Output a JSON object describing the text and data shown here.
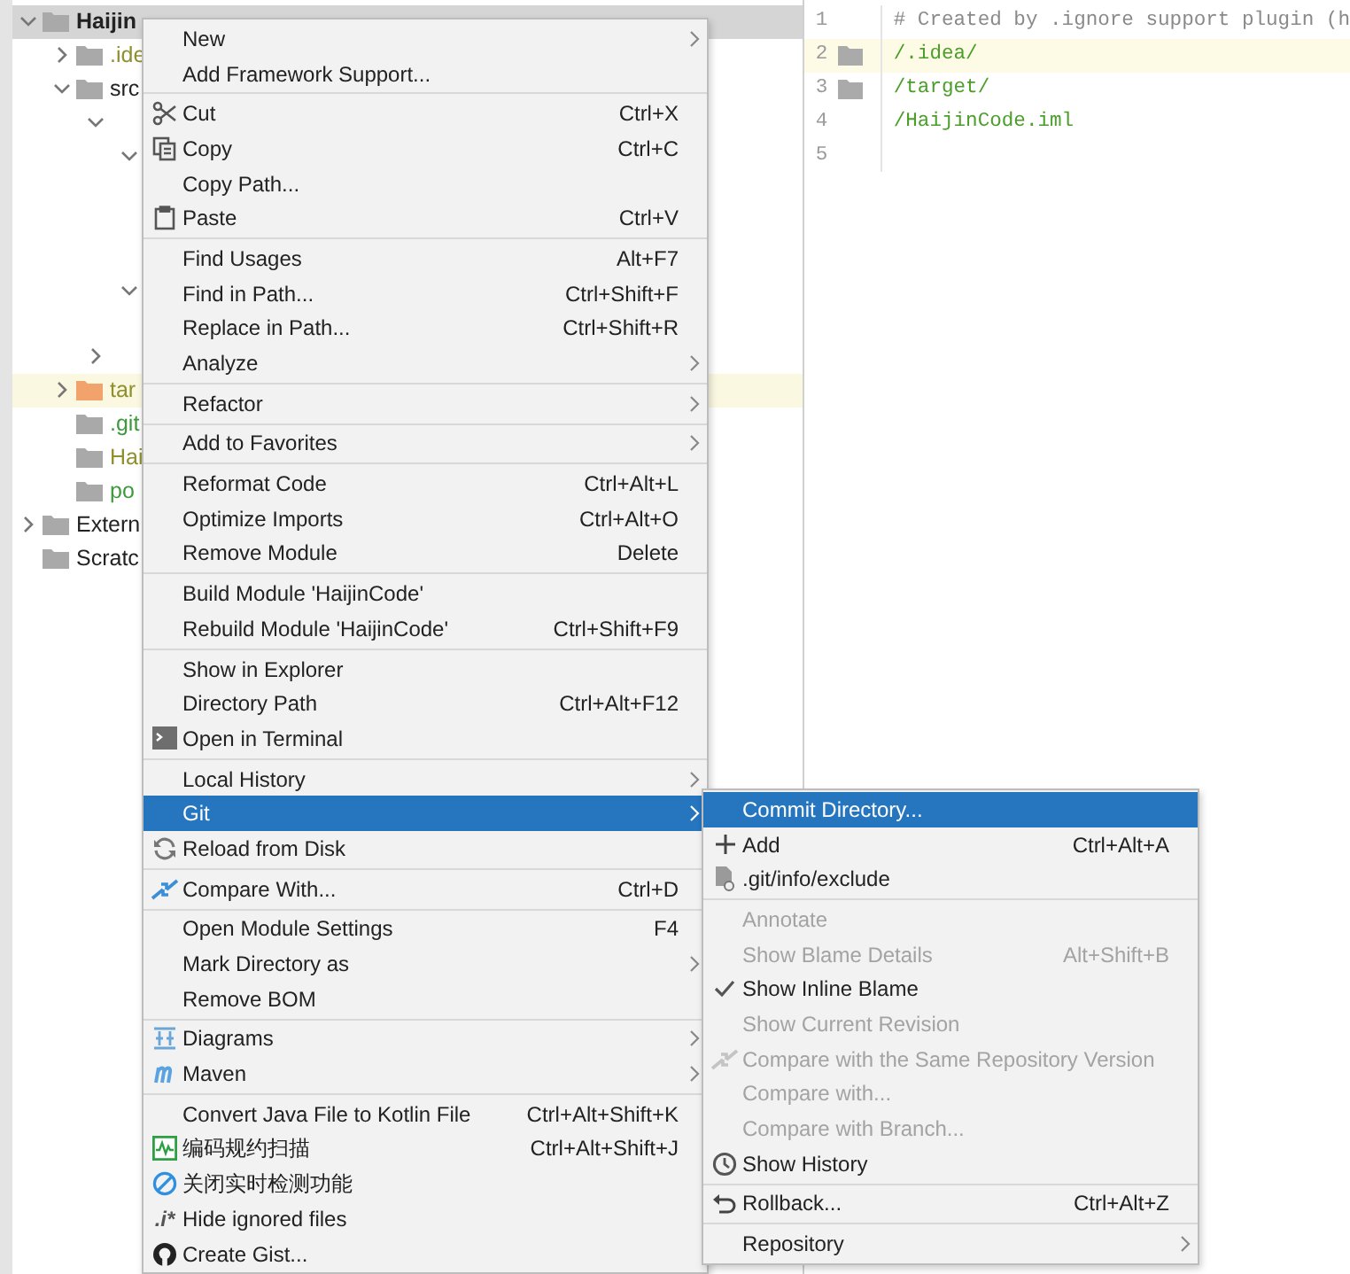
{
  "project_tree": [
    {
      "label": "Haijin",
      "bold": true,
      "expanded": true,
      "selected": true,
      "highlighted": false,
      "children": [
        {
          "label": ".ide",
          "color": "#8f8f2e",
          "expanded": false,
          "selected": false,
          "highlighted": false
        },
        {
          "label": "src",
          "expanded": true,
          "selected": false,
          "highlighted": false,
          "children": [
            {
              "expanded": true,
              "selected": false,
              "highlighted": false,
              "children": [
                {
                  "expanded": true,
                  "selected": false,
                  "highlighted": false,
                  "children": [
                    {
                      "selected": false,
                      "highlighted": false
                    },
                    {
                      "selected": false,
                      "highlighted": false
                    },
                    {
                      "selected": false,
                      "highlighted": false
                    }
                  ]
                },
                {
                  "expanded": true,
                  "selected": false,
                  "highlighted": false,
                  "children": [
                    {
                      "selected": false,
                      "highlighted": false
                    }
                  ]
                }
              ]
            },
            {
              "expanded": false,
              "selected": false,
              "highlighted": false
            }
          ]
        },
        {
          "label": "tar",
          "color": "#8f8f2e",
          "expanded": false,
          "selected": false,
          "highlighted": true
        },
        {
          "label": ".git",
          "color": "#3c9a3c",
          "selected": false,
          "highlighted": false
        },
        {
          "label": "Hai",
          "color": "#8f8f2e",
          "selected": false,
          "highlighted": false
        },
        {
          "label": "po",
          "color": "#3c9a3c",
          "selected": false,
          "highlighted": false
        }
      ]
    },
    {
      "label": "Extern",
      "expanded": false,
      "selected": false,
      "highlighted": false
    },
    {
      "label": "Scratc",
      "selected": false,
      "highlighted": false
    }
  ],
  "editor": {
    "lines": [
      {
        "number": "1",
        "text": "# Created by .ignore support plugin (h",
        "kind": "comment",
        "folder": false,
        "current": false
      },
      {
        "number": "2",
        "text": "/.idea/",
        "kind": "path",
        "folder": true,
        "current": true
      },
      {
        "number": "3",
        "text": "/target/",
        "kind": "path",
        "folder": true,
        "current": false
      },
      {
        "number": "4",
        "text": "/HaijinCode.iml",
        "kind": "path",
        "folder": false,
        "current": false
      },
      {
        "number": "5",
        "folder": false,
        "current": false
      }
    ]
  },
  "context_menu": {
    "groups": [
      [
        {
          "label": "New",
          "submenu": true,
          "selected": false
        },
        {
          "label": "Add Framework Support...",
          "submenu": false,
          "selected": false
        }
      ],
      [
        {
          "label": "Cut",
          "shortcut": "Ctrl+X",
          "submenu": false,
          "selected": false
        },
        {
          "label": "Copy",
          "shortcut": "Ctrl+C",
          "submenu": false,
          "selected": false
        },
        {
          "label": "Copy Path...",
          "submenu": false,
          "selected": false
        },
        {
          "label": "Paste",
          "shortcut": "Ctrl+V",
          "submenu": false,
          "selected": false
        }
      ],
      [
        {
          "label": "Find Usages",
          "shortcut": "Alt+F7",
          "submenu": false,
          "selected": false
        },
        {
          "label": "Find in Path...",
          "shortcut": "Ctrl+Shift+F",
          "submenu": false,
          "selected": false
        },
        {
          "label": "Replace in Path...",
          "shortcut": "Ctrl+Shift+R",
          "submenu": false,
          "selected": false
        },
        {
          "label": "Analyze",
          "submenu": true,
          "selected": false
        }
      ],
      [
        {
          "label": "Refactor",
          "submenu": true,
          "selected": false
        }
      ],
      [
        {
          "label": "Add to Favorites",
          "submenu": true,
          "selected": false
        }
      ],
      [
        {
          "label": "Reformat Code",
          "shortcut": "Ctrl+Alt+L",
          "submenu": false,
          "selected": false
        },
        {
          "label": "Optimize Imports",
          "shortcut": "Ctrl+Alt+O",
          "submenu": false,
          "selected": false
        },
        {
          "label": "Remove Module",
          "shortcut": "Delete",
          "submenu": false,
          "selected": false
        }
      ],
      [
        {
          "label": "Build Module 'HaijinCode'",
          "submenu": false,
          "selected": false
        },
        {
          "label": "Rebuild Module 'HaijinCode'",
          "shortcut": "Ctrl+Shift+F9",
          "submenu": false,
          "selected": false
        }
      ],
      [
        {
          "label": "Show in Explorer",
          "submenu": false,
          "selected": false
        },
        {
          "label": "Directory Path",
          "shortcut": "Ctrl+Alt+F12",
          "submenu": false,
          "selected": false
        },
        {
          "label": "Open in Terminal",
          "submenu": false,
          "selected": false
        }
      ],
      [
        {
          "label": "Local History",
          "submenu": true,
          "selected": false
        },
        {
          "label": "Git",
          "submenu": true,
          "selected": true
        },
        {
          "label": "Reload from Disk",
          "submenu": false,
          "selected": false
        }
      ],
      [
        {
          "label": "Compare With...",
          "shortcut": "Ctrl+D",
          "submenu": false,
          "selected": false
        }
      ],
      [
        {
          "label": "Open Module Settings",
          "shortcut": "F4",
          "submenu": false,
          "selected": false
        },
        {
          "label": "Mark Directory as",
          "submenu": true,
          "selected": false
        },
        {
          "label": "Remove BOM",
          "submenu": false,
          "selected": false
        }
      ],
      [
        {
          "label": "Diagrams",
          "submenu": true,
          "selected": false
        },
        {
          "label": "Maven",
          "submenu": true,
          "selected": false
        }
      ],
      [
        {
          "label": "Convert Java File to Kotlin File",
          "shortcut": "Ctrl+Alt+Shift+K",
          "submenu": false,
          "selected": false
        },
        {
          "label": "编码规约扫描",
          "shortcut": "Ctrl+Alt+Shift+J",
          "submenu": false,
          "selected": false
        },
        {
          "label": "关闭实时检测功能",
          "submenu": false,
          "selected": false
        },
        {
          "label": "Hide ignored files",
          "icon_text": ".i*",
          "submenu": false,
          "selected": false
        },
        {
          "label": "Create Gist...",
          "submenu": false,
          "selected": false
        }
      ]
    ]
  },
  "git_submenu": {
    "groups": [
      [
        {
          "label": "Commit Directory...",
          "submenu": false,
          "selected": true,
          "disabled": false,
          "checked": false
        },
        {
          "label": "Add",
          "shortcut": "Ctrl+Alt+A",
          "submenu": false,
          "selected": false,
          "disabled": false,
          "checked": false
        },
        {
          "label": ".git/info/exclude",
          "submenu": false,
          "selected": false,
          "disabled": false,
          "checked": false
        }
      ],
      [
        {
          "label": "Annotate",
          "submenu": false,
          "selected": false,
          "disabled": true,
          "checked": false
        },
        {
          "label": "Show Blame Details",
          "shortcut": "Alt+Shift+B",
          "submenu": false,
          "selected": false,
          "disabled": true,
          "checked": false
        },
        {
          "label": "Show Inline Blame",
          "submenu": false,
          "selected": false,
          "disabled": false,
          "checked": true
        },
        {
          "label": "Show Current Revision",
          "submenu": false,
          "selected": false,
          "disabled": true,
          "checked": false
        },
        {
          "label": "Compare with the Same Repository Version",
          "submenu": false,
          "selected": false,
          "disabled": true,
          "checked": false
        },
        {
          "label": "Compare with...",
          "submenu": false,
          "selected": false,
          "disabled": true,
          "checked": false
        },
        {
          "label": "Compare with Branch...",
          "submenu": false,
          "selected": false,
          "disabled": true,
          "checked": false
        },
        {
          "label": "Show History",
          "submenu": false,
          "selected": false,
          "disabled": false,
          "checked": false
        }
      ],
      [
        {
          "label": "Rollback...",
          "shortcut": "Ctrl+Alt+Z",
          "submenu": false,
          "selected": false,
          "disabled": false,
          "checked": false
        }
      ],
      [
        {
          "label": "Repository",
          "submenu": true,
          "selected": false,
          "disabled": false,
          "checked": false
        }
      ]
    ]
  }
}
